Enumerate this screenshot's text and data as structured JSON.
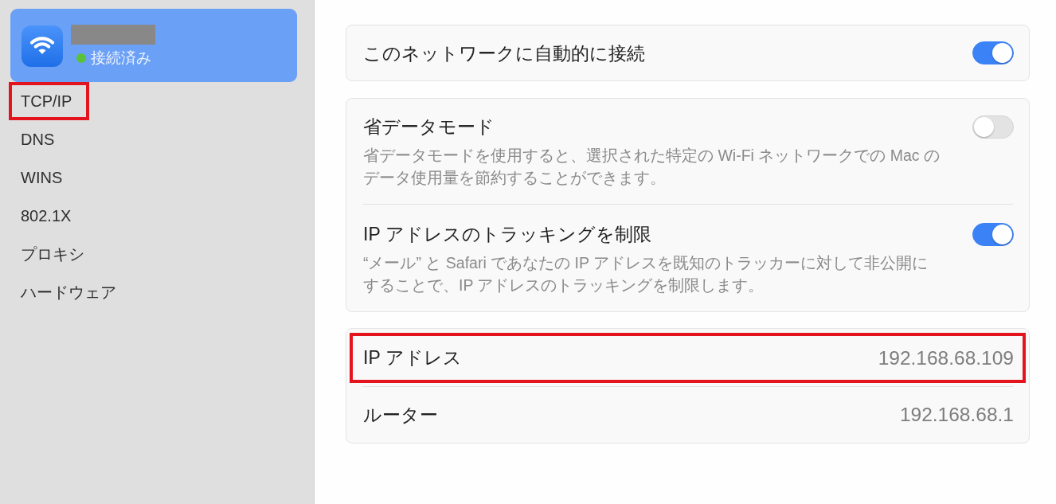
{
  "sidebar": {
    "network": {
      "selected": true,
      "name_hidden": true,
      "connected": true,
      "status": "接続済み"
    },
    "items": [
      {
        "label": "TCP/IP",
        "selected": false,
        "highlighted": true
      },
      {
        "label": "DNS",
        "selected": false,
        "highlighted": false
      },
      {
        "label": "WINS",
        "selected": false,
        "highlighted": false
      },
      {
        "label": "802.1X",
        "selected": false,
        "highlighted": false
      },
      {
        "label": "プロキシ",
        "selected": false,
        "highlighted": false
      },
      {
        "label": "ハードウェア",
        "selected": false,
        "highlighted": false
      }
    ]
  },
  "auto_connect": {
    "label": "このネットワークに自動的に接続",
    "on": true
  },
  "options": [
    {
      "title": "省データモード",
      "description": "省データモードを使用すると、選択された特定の Wi-Fi ネットワークでの Mac のデータ使用量を節約することができます。",
      "on": false
    },
    {
      "title": "IP アドレスのトラッキングを制限",
      "description": "“メール” と Safari であなたの IP アドレスを既知のトラッカーに対して非公開にすることで、IP アドレスのトラッキングを制限します。",
      "on": true
    }
  ],
  "info": [
    {
      "label": "IP アドレス",
      "value": "192.168.68.109",
      "highlighted": true
    },
    {
      "label": "ルーター",
      "value": "192.168.68.1",
      "highlighted": false
    }
  ]
}
